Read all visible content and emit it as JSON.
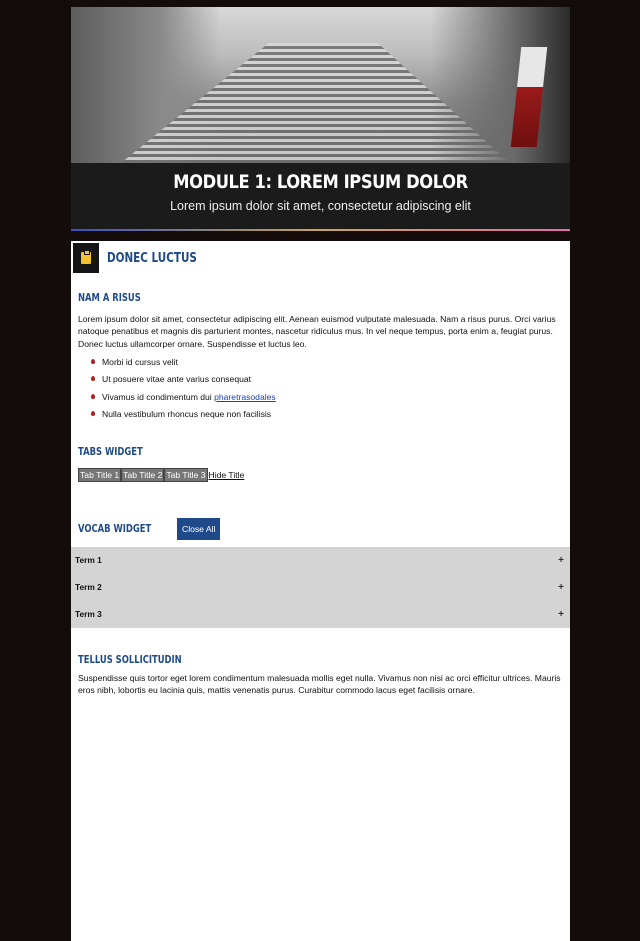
{
  "hero": {
    "title": "Module 1: Lorem ipsum dolor",
    "subtitle": "Lorem ipsum dolor sit amet, consectetur adipiscing elit"
  },
  "section": {
    "icon": "clipboard-icon",
    "title": "Donec luctus"
  },
  "block1": {
    "heading": "Nam a risus",
    "paragraph": "Lorem ipsum dolor sit amet, consectetur adipiscing elit. Aenean euismod vulputate malesuada. Nam a risus purus. Orci varius natoque penatibus et magnis dis parturient montes, nascetur ridiculus mus. In vel neque tempus, porta enim a, feugiat purus. Donec luctus ullamcorper ornare. Suspendisse et luctus leo.",
    "bullets": [
      {
        "text": "Morbi id cursus velit"
      },
      {
        "text": "Ut posuere vitae ante varius consequat"
      },
      {
        "text": "Vivamus id condimentum dui ",
        "link": "pharetrasodales"
      },
      {
        "text": "Nulla vestibulum rhoncus neque non facilisis"
      }
    ]
  },
  "tabs_widget": {
    "heading": "Tabs Widget",
    "tabs": [
      "Tab Title 1",
      "Tab Title 2",
      "Tab Title 3"
    ],
    "hide_label": "Hide Title"
  },
  "vocab_widget": {
    "heading": "Vocab Widget",
    "close_all_label": "Close All",
    "terms": [
      "Term 1",
      "Term 2",
      "Term 3"
    ]
  },
  "block2": {
    "heading": "Tellus sollicitudin",
    "paragraph": "Suspendisse quis tortor eget lorem condimentum malesuada mollis eget nulla. Vivamus non nisi ac orci efficitur ultrices. Mauris eros nibh, lobortis eu lacinia quis, mattis venenatis purus. Curabitur commodo lacus eget facilisis ornare."
  },
  "colors": {
    "heading_blue": "#1f4a8a",
    "bullet_red": "#b21d1d",
    "page_bg": "#140c0a"
  }
}
